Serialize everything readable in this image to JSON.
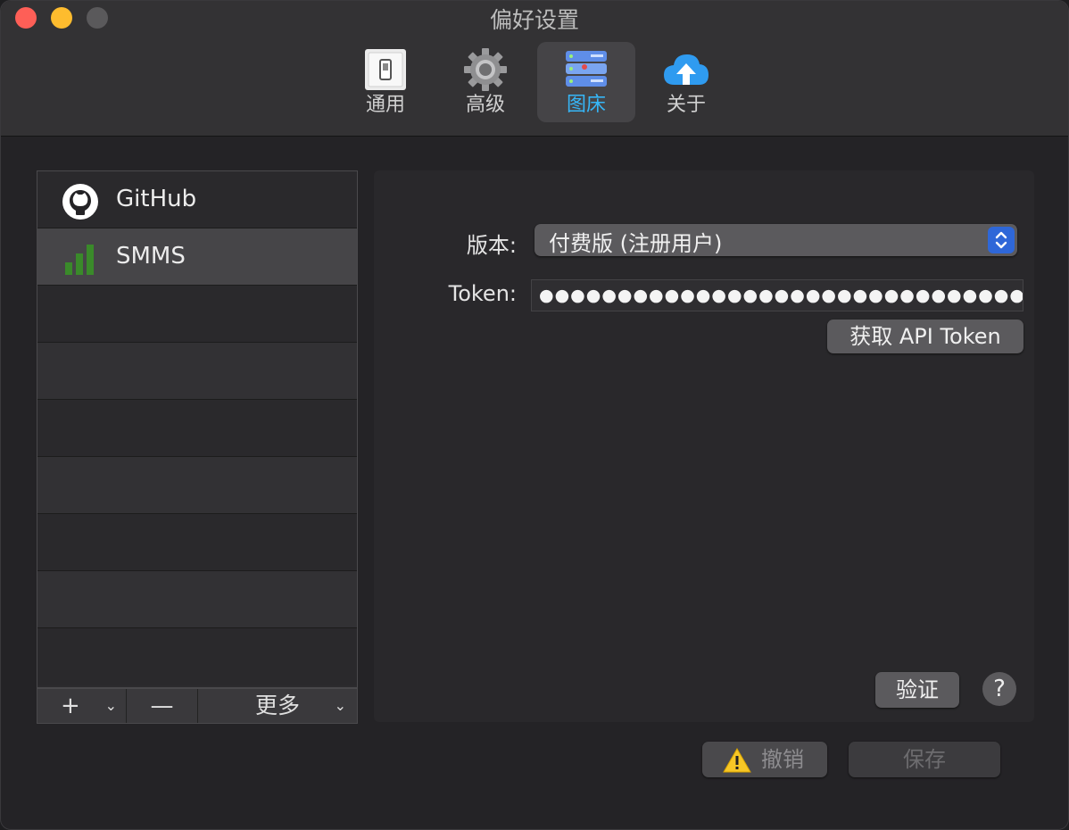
{
  "window": {
    "title": "偏好设置"
  },
  "toolbar": {
    "items": [
      {
        "label": "通用",
        "icon": "switch-icon"
      },
      {
        "label": "高级",
        "icon": "gear-icon"
      },
      {
        "label": "图床",
        "icon": "server-icon"
      },
      {
        "label": "关于",
        "icon": "cloud-upload-icon"
      }
    ],
    "active_index": 2
  },
  "sidebar": {
    "items": [
      {
        "label": "GitHub",
        "icon": "github-icon"
      },
      {
        "label": "SMMS",
        "icon": "signal-bars-icon"
      }
    ],
    "selected_index": 1,
    "footer": {
      "add_label": "+",
      "remove_label": "—",
      "more_label": "更多"
    }
  },
  "form": {
    "version_label": "版本:",
    "version_value": "付费版 (注册用户)",
    "token_label": "Token:",
    "token_value": "●●●●●●●●●●●●●●●●●●●●●●●●●●●●●●●●",
    "get_token_label": "获取 API Token",
    "verify_label": "验证",
    "help_label": "?"
  },
  "footer": {
    "undo_label": "撤销",
    "save_label": "保存"
  },
  "colors": {
    "accent": "#36b6f7",
    "select_blue": "#2e67d8",
    "github_green": "#3a8a2a"
  }
}
